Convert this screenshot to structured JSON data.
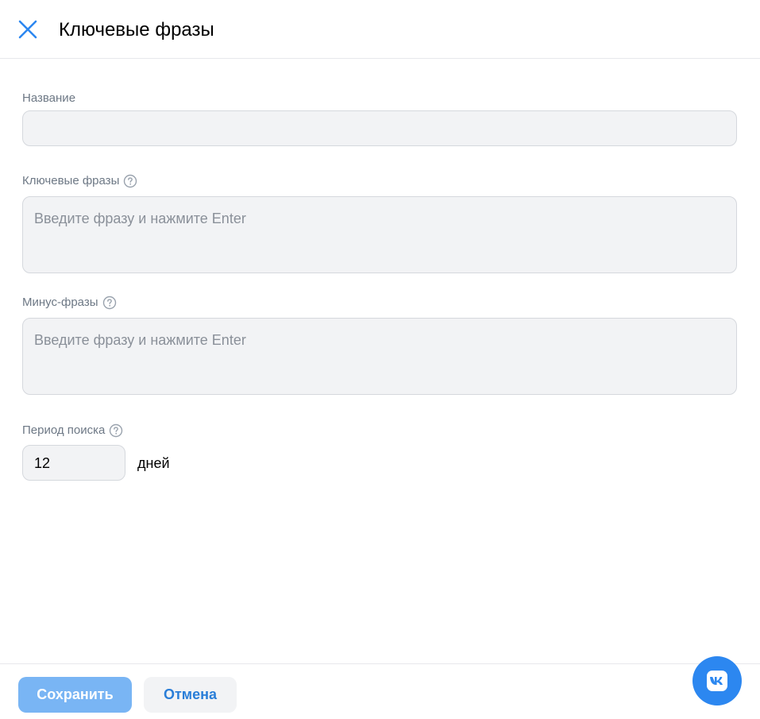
{
  "header": {
    "title": "Ключевые фразы",
    "close_icon": "close-icon"
  },
  "form": {
    "name": {
      "label": "Название",
      "value": "",
      "placeholder": ""
    },
    "keyphrases": {
      "label": "Ключевые фразы",
      "placeholder": "Введите фразу и нажмите Enter",
      "help_icon": "question-circle-icon"
    },
    "minus_phrases": {
      "label": "Минус-фразы",
      "placeholder": "Введите фразу и нажмите Enter",
      "help_icon": "question-circle-icon"
    },
    "period": {
      "label": "Период поиска",
      "value": "12",
      "unit": "дней",
      "help_icon": "question-circle-icon"
    }
  },
  "footer": {
    "save_label": "Сохранить",
    "cancel_label": "Отмена"
  },
  "fab": {
    "icon": "vk-logo-icon",
    "logo_text": "VK"
  },
  "colors": {
    "accent": "#2c87f0",
    "save_button_disabled": "#79b5f4",
    "cancel_text": "#2a7ed8",
    "field_bg": "#f2f3f5",
    "label": "#6d7885"
  }
}
